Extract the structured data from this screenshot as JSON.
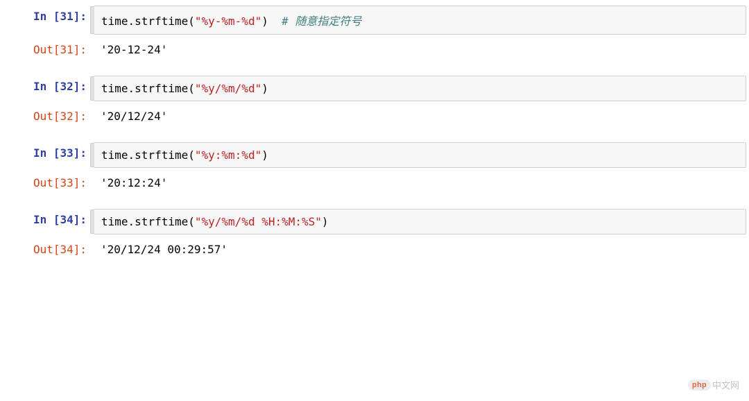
{
  "cells": [
    {
      "in_prompt": "In [31]:",
      "out_prompt": "Out[31]:",
      "code": {
        "prefix": "time",
        "dot": ".",
        "method": "strftime",
        "open": "(",
        "string": "\"%y-%m-%d\"",
        "close": ")",
        "comment": "  # 随意指定符号"
      },
      "output": "'20-12-24'"
    },
    {
      "in_prompt": "In [32]:",
      "out_prompt": "Out[32]:",
      "code": {
        "prefix": "time",
        "dot": ".",
        "method": "strftime",
        "open": "(",
        "string": "\"%y/%m/%d\"",
        "close": ")",
        "comment": ""
      },
      "output": "'20/12/24'"
    },
    {
      "in_prompt": "In [33]:",
      "out_prompt": "Out[33]:",
      "code": {
        "prefix": "time",
        "dot": ".",
        "method": "strftime",
        "open": "(",
        "string": "\"%y:%m:%d\"",
        "close": ")",
        "comment": ""
      },
      "output": "'20:12:24'"
    },
    {
      "in_prompt": "In [34]:",
      "out_prompt": "Out[34]:",
      "code": {
        "prefix": "time",
        "dot": ".",
        "method": "strftime",
        "open": "(",
        "string": "\"%y/%m/%d %H:%M:%S\"",
        "close": ")",
        "comment": ""
      },
      "output": "'20/12/24 00:29:57'"
    }
  ],
  "watermark": {
    "badge": "php",
    "text": "中文网"
  }
}
